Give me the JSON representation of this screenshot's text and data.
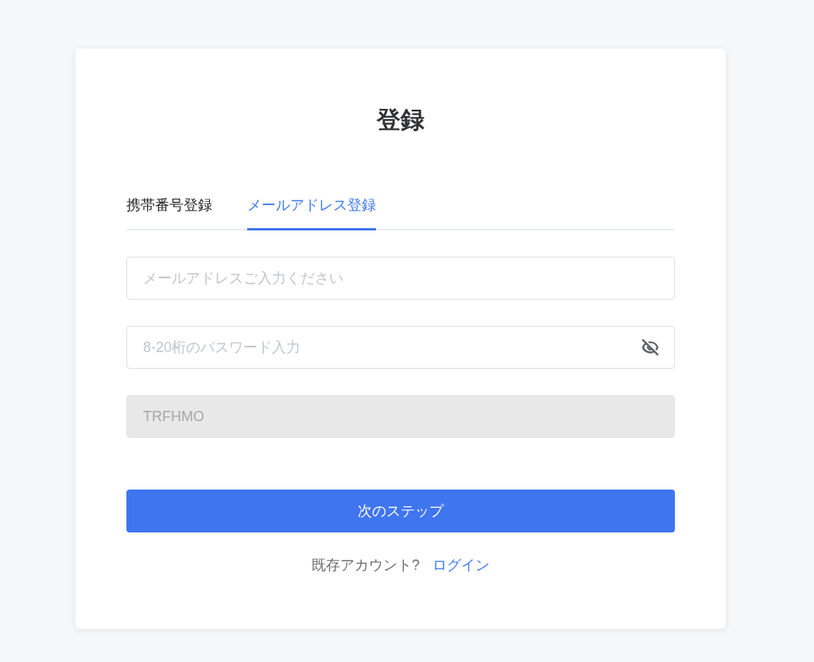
{
  "title": "登録",
  "tabs": [
    {
      "label": "携帯番号登録",
      "selected": false
    },
    {
      "label": "メールアドレス登録",
      "selected": true
    }
  ],
  "fields": [
    {
      "kind": "text",
      "placeholder": "メールアドレスご入力ください",
      "disabled": false
    },
    {
      "kind": "password",
      "placeholder": "8-20桁のパスワード入力",
      "disabled": false
    },
    {
      "kind": "text",
      "value": "TRFHMO",
      "disabled": true
    }
  ],
  "submit_button": "次のステップ",
  "footer": {
    "prompt": "既存アカウント?",
    "link": "ログイン"
  }
}
